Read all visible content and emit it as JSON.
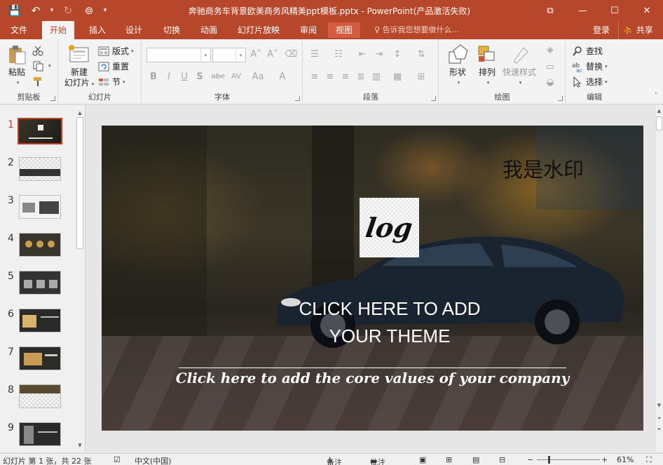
{
  "window": {
    "title": "奔驰商务车背景欧美商务风精美ppt模板.pptx - PowerPoint(产品激活失败)",
    "controls": [
      "⧉",
      "—",
      "☐",
      "✕"
    ]
  },
  "qat": {
    "save": "💾",
    "undo": "↶",
    "redo": "↻",
    "present": "⊚",
    "more": "▾"
  },
  "tabs": [
    "文件",
    "开始",
    "插入",
    "设计",
    "切换",
    "动画",
    "幻灯片放映",
    "审阅",
    "视图"
  ],
  "tell_me": "告诉我您想要做什么...",
  "account": {
    "login": "登录",
    "share": "共享"
  },
  "ribbon": {
    "clipboard": {
      "label": "剪贴板",
      "paste": "粘贴"
    },
    "slides": {
      "label": "幻灯片",
      "new_slide_line1": "新建",
      "new_slide_line2": "幻灯片",
      "layout": "版式",
      "reset": "重置",
      "section": "节"
    },
    "font": {
      "label": "字体",
      "bold": "B",
      "italic": "I",
      "underline": "U",
      "shadow": "S",
      "strike": "abc",
      "spacing": "AV",
      "case": "Aa",
      "color": "A",
      "grow": "A˄",
      "shrink": "A˅"
    },
    "paragraph": {
      "label": "段落"
    },
    "drawing": {
      "label": "绘图",
      "shapes": "形状",
      "arrange": "排列",
      "quick_styles": "快速样式"
    },
    "editing": {
      "label": "编辑",
      "find": "查找",
      "replace": "替换",
      "select": "选择"
    }
  },
  "thumbnails": [
    "1",
    "2",
    "3",
    "4",
    "5",
    "6",
    "7",
    "8",
    "9"
  ],
  "slide": {
    "watermark": "我是水印",
    "logo": "log",
    "theme_line1": "CLICK HERE TO ADD",
    "theme_line2": "YOUR THEME",
    "core_values": "Click here to add the core values of your company"
  },
  "status": {
    "slide_info": "幻灯片 第 1 张，共 22 张",
    "language": "中文(中国)",
    "notes": "备注",
    "comments": "批注",
    "zoom": "61%"
  },
  "colors": {
    "accent": "#b7472a",
    "active_thumb": "#c43e1c"
  }
}
